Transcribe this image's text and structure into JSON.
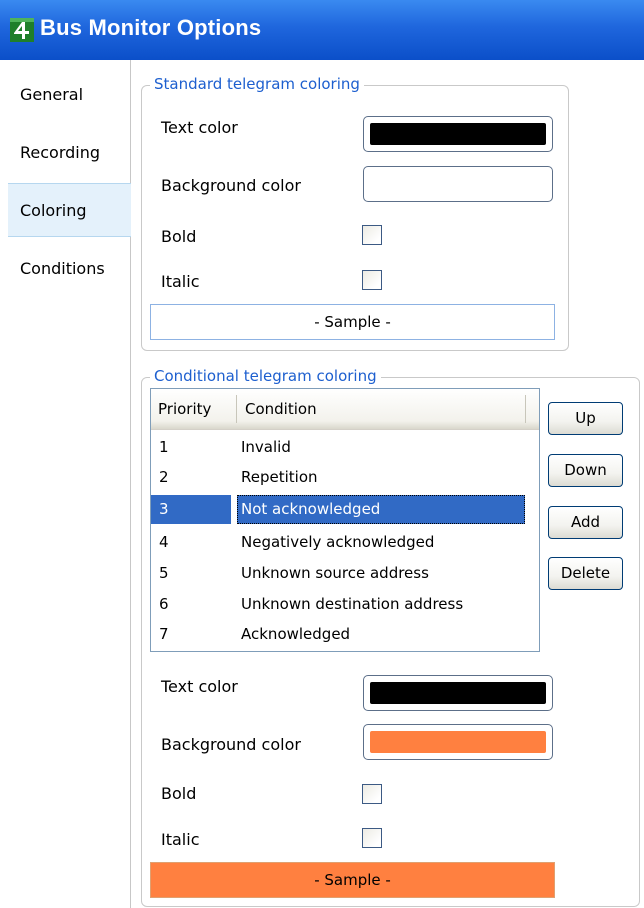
{
  "window": {
    "title": "Bus Monitor Options",
    "icon": "app-logo-icon"
  },
  "nav": {
    "items": [
      {
        "label": "General",
        "selected": false
      },
      {
        "label": "Recording",
        "selected": false
      },
      {
        "label": "Coloring",
        "selected": true
      },
      {
        "label": "Conditions",
        "selected": false
      }
    ]
  },
  "standard": {
    "legend": "Standard telegram coloring",
    "text_color_label": "Text color",
    "text_color": "#000000",
    "background_color_label": "Background color",
    "background_color": "",
    "bold_label": "Bold",
    "bold_checked": false,
    "italic_label": "Italic",
    "italic_checked": false,
    "sample_label": "- Sample -"
  },
  "conditional": {
    "legend": "Conditional telegram coloring",
    "columns": [
      "Priority",
      "Condition"
    ],
    "rows": [
      {
        "priority": "1",
        "condition": "Invalid"
      },
      {
        "priority": "2",
        "condition": "Repetition"
      },
      {
        "priority": "3",
        "condition": "Not acknowledged"
      },
      {
        "priority": "4",
        "condition": "Negatively acknowledged"
      },
      {
        "priority": "5",
        "condition": "Unknown source address"
      },
      {
        "priority": "6",
        "condition": "Unknown destination address"
      },
      {
        "priority": "7",
        "condition": "Acknowledged"
      }
    ],
    "selected_priority": "3",
    "buttons": {
      "up": "Up",
      "down": "Down",
      "add": "Add",
      "delete": "Delete"
    },
    "text_color_label": "Text color",
    "text_color": "#000000",
    "background_color_label": "Background color",
    "background_color": "#ff8040",
    "bold_label": "Bold",
    "bold_checked": false,
    "italic_label": "Italic",
    "italic_checked": false,
    "sample_label": "- Sample -"
  },
  "colors": {
    "accent": "#1d5fcf",
    "selection": "#316ac5",
    "titlebar": "#1f66dd"
  }
}
